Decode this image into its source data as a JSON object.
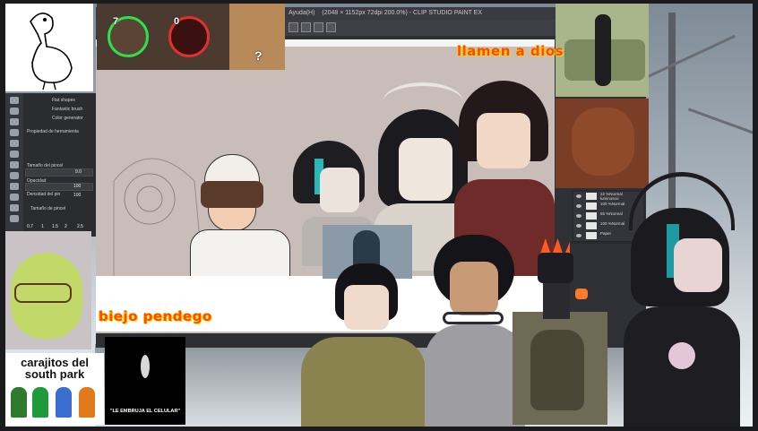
{
  "window": {
    "title": "(2048 × 1152px 72dpi 200.0%) - CLIP STUDIO PAINT EX",
    "menu_help": "Ayuda(H)"
  },
  "tool_property": {
    "brush_shapes": "Flat shapes",
    "fantastic_brush": "Fantastic brush",
    "color_generator": "Color generator",
    "panel_title": "Propiedad de herramienta",
    "brush_size_label": "Tamaño del pincel",
    "brush_size_value": "9.0",
    "opacity_label": "Opacidad",
    "opacity_value": "100",
    "density_label": "Densidad del pin",
    "density_value": "100",
    "brush_size_preset_label": "Tamaño de pincel",
    "presets": [
      "0.7",
      "1",
      "1.5",
      "2",
      "2.5"
    ]
  },
  "layers": [
    {
      "opacity": "22 %",
      "blend": "Normal",
      "name": "luminosoo"
    },
    {
      "opacity": "100 %",
      "blend": "Normal",
      "name": ""
    },
    {
      "opacity": "55 %",
      "blend": "Normal",
      "name": ""
    },
    {
      "opacity": "100 %",
      "blend": "Normal",
      "name": ""
    },
    {
      "opacity": "",
      "blend": "",
      "name": "Paper"
    }
  ],
  "overlays": {
    "top_right_text": "llamen a dios",
    "bottom_text": "biejo pendego",
    "badge_left_num": "7",
    "badge_right_num": "0",
    "doge_question": "?",
    "south_park_caption_1": "carajitos del",
    "south_park_caption_2": "south park",
    "black_box_caption": "\"LE EMBRUJA EL CELULAR\""
  },
  "colors": {
    "background": "#1b1b1d",
    "overlay_orange": "#ff4a00",
    "badge_green": "#2ee04a",
    "canvas_bg": "#c9bdba"
  }
}
